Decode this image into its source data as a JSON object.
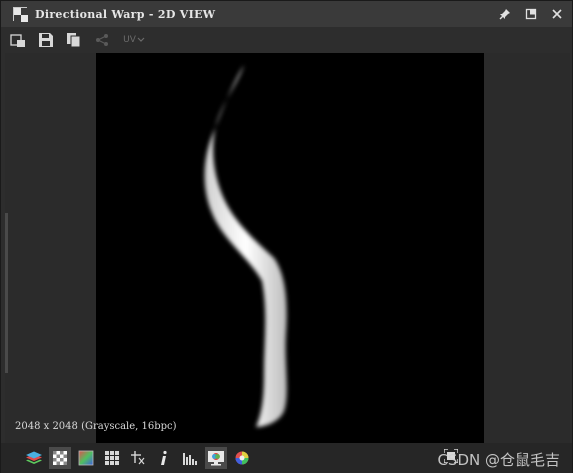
{
  "window": {
    "title": "Directional Warp - 2D VIEW"
  },
  "title_controls": {
    "icons": [
      "pin-icon",
      "restore-icon",
      "close-icon"
    ]
  },
  "toolbar": {
    "icons": [
      "copy-to-icon",
      "save-icon",
      "copy-icon",
      "share-icon"
    ],
    "uv_label": "UV"
  },
  "viewport": {
    "size_info": "2048 x 2048 (Grayscale, 16bpc)"
  },
  "bottom_toolbar": {
    "icons": [
      "layers-icon",
      "checker-background-icon",
      "color-gradient-icon",
      "grid-icon",
      "tile-icon",
      "info-icon",
      "histogram-icon",
      "monitor-icon",
      "color-wheel-icon"
    ]
  },
  "watermark": "CSDN @仓鼠毛吉"
}
